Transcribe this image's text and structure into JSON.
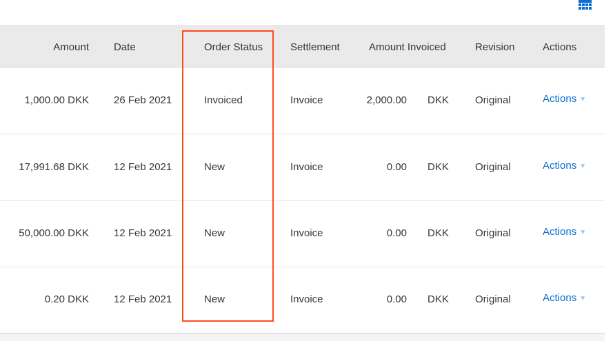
{
  "table": {
    "headers": {
      "amount": "Amount",
      "date": "Date",
      "order_status": "Order Status",
      "settlement": "Settlement",
      "amount_invoiced": "Amount Invoiced",
      "revision": "Revision",
      "actions": "Actions"
    },
    "rows": [
      {
        "amount": "1,000.00 DKK",
        "date": "26 Feb 2021",
        "order_status": "Invoiced",
        "settlement": "Invoice",
        "amount_invoiced_value": "2,000.00",
        "amount_invoiced_currency": "DKK",
        "revision": "Original",
        "actions": "Actions"
      },
      {
        "amount": "17,991.68 DKK",
        "date": "12 Feb 2021",
        "order_status": "New",
        "settlement": "Invoice",
        "amount_invoiced_value": "0.00",
        "amount_invoiced_currency": "DKK",
        "revision": "Original",
        "actions": "Actions"
      },
      {
        "amount": "50,000.00 DKK",
        "date": "12 Feb 2021",
        "order_status": "New",
        "settlement": "Invoice",
        "amount_invoiced_value": "0.00",
        "amount_invoiced_currency": "DKK",
        "revision": "Original",
        "actions": "Actions"
      },
      {
        "amount": "0.20 DKK",
        "date": "12 Feb 2021",
        "order_status": "New",
        "settlement": "Invoice",
        "amount_invoiced_value": "0.00",
        "amount_invoiced_currency": "DKK",
        "revision": "Original",
        "actions": "Actions"
      }
    ]
  },
  "icons": {
    "table_settings": "grid-table-icon",
    "actions_caret": "caret-down-icon"
  },
  "colors": {
    "accent": "#0a6ed1",
    "highlight_border": "#ff4a1f",
    "header_background": "#eaeaea"
  }
}
